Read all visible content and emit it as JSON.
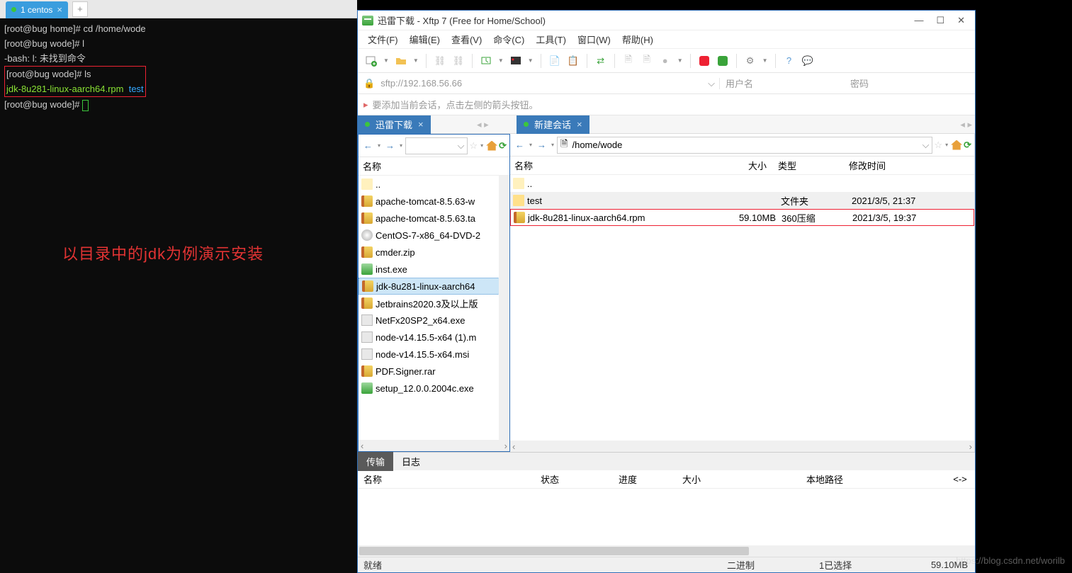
{
  "terminal": {
    "tab_label": "1 centos",
    "lines": {
      "l1_prompt": "[root@bug home]#",
      "l1_cmd": "cd /home/wode",
      "l2_prompt": "[root@bug wode]#",
      "l2_cmd": "l",
      "l3": "-bash: l: 未找到命令",
      "l4_prompt": "[root@bug wode]#",
      "l4_cmd": "ls",
      "l5_a": "jdk-8u281-linux-aarch64.rpm",
      "l5_b": "test",
      "l6_prompt": "[root@bug wode]#"
    },
    "callout": "以目录中的jdk为例演示安装"
  },
  "xftp": {
    "title": "迅雷下载 - Xftp 7 (Free for Home/School)",
    "menu": {
      "file": "文件(F)",
      "edit": "编辑(E)",
      "view": "查看(V)",
      "cmd": "命令(C)",
      "tool": "工具(T)",
      "window": "窗口(W)",
      "help": "帮助(H)"
    },
    "addr": "sftp://192.168.56.66",
    "user_label": "用户名",
    "pass_label": "密码",
    "hint": "要添加当前会话，点击左侧的箭头按钮。",
    "tab_left": "迅雷下载",
    "tab_right": "新建会话",
    "remote_path": "/home/wode",
    "cols": {
      "name": "名称",
      "size": "大小",
      "type": "类型",
      "mtime": "修改时间"
    },
    "local_files": [
      "..",
      "apache-tomcat-8.5.63-w",
      "apache-tomcat-8.5.63.ta",
      "CentOS-7-x86_64-DVD-2",
      "cmder.zip",
      "inst.exe",
      "jdk-8u281-linux-aarch64",
      "Jetbrains2020.3及以上版",
      "NetFx20SP2_x64.exe",
      "node-v14.15.5-x64 (1).m",
      "node-v14.15.5-x64.msi",
      "PDF.Signer.rar",
      "setup_12.0.0.2004c.exe"
    ],
    "remote_files": [
      {
        "name": "..",
        "size": "",
        "type": "",
        "mtime": ""
      },
      {
        "name": "test",
        "size": "",
        "type": "文件夹",
        "mtime": "2021/3/5, 21:37"
      },
      {
        "name": "jdk-8u281-linux-aarch64.rpm",
        "size": "59.10MB",
        "type": "360压缩",
        "mtime": "2021/3/5, 19:37"
      }
    ],
    "transfer": {
      "tab1": "传输",
      "tab2": "日志",
      "c1": "名称",
      "c2": "状态",
      "c3": "进度",
      "c4": "大小",
      "c5": "本地路径",
      "c6": "<->"
    },
    "status": {
      "ready": "就绪",
      "binary": "二进制",
      "sel": "1已选择",
      "size": "59.10MB"
    }
  },
  "watermark": "https://blog.csdn.net/worilb"
}
